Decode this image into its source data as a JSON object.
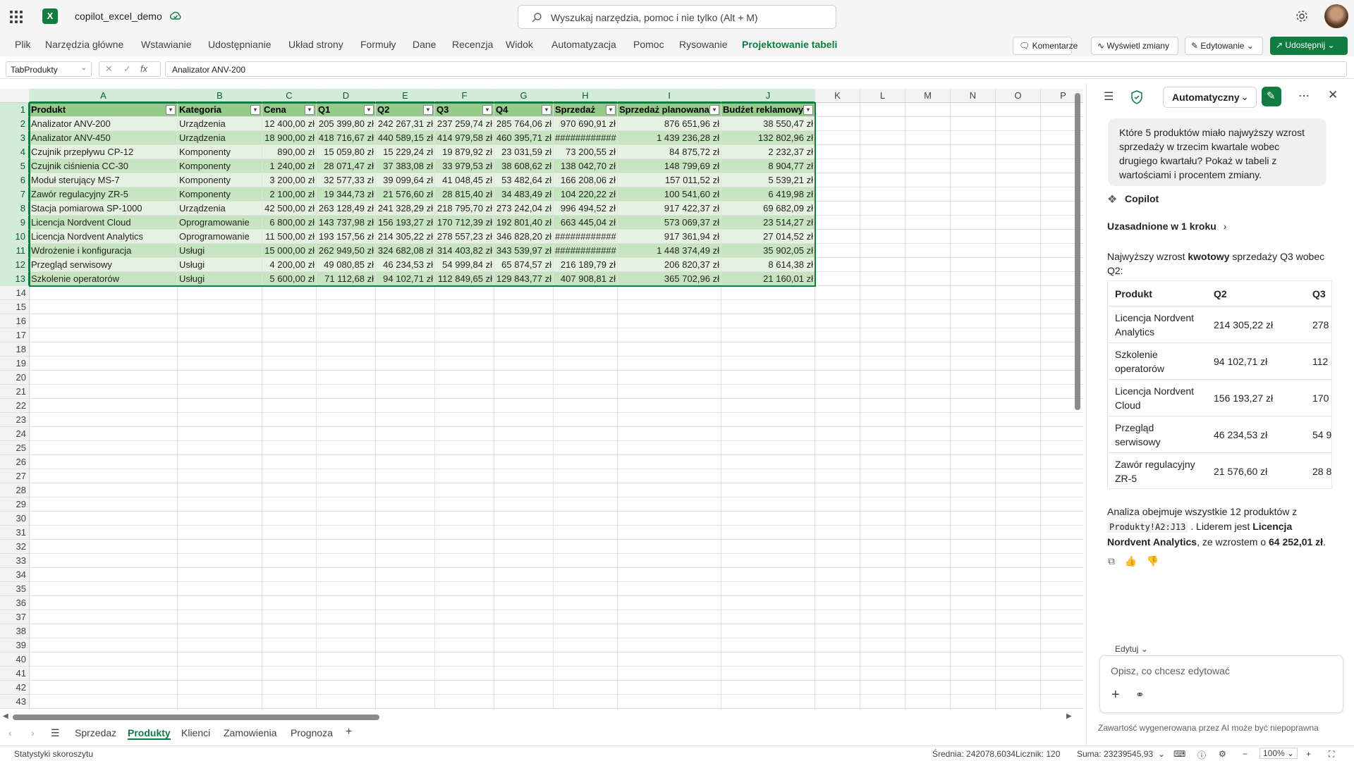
{
  "app": {
    "doc_title": "copilot_excel_demo",
    "search_placeholder": "Wyszukaj narzędzia, pomoc i nie tylko (Alt + M)"
  },
  "menu": [
    "Plik",
    "Narzędzia główne",
    "Wstawianie",
    "Udostępnianie",
    "Układ strony",
    "Formuły",
    "Dane",
    "Recenzja",
    "Widok",
    "Automatyzacja",
    "Pomoc",
    "Rysowanie",
    "Projektowanie tabeli"
  ],
  "menu_active": "Projektowanie tabeli",
  "toolbar": {
    "comments": "Komentarze",
    "changes": "Wyświetl zmiany",
    "editing": "Edytowanie",
    "share": "Udostępnij"
  },
  "formula_bar": {
    "name_box": "TabProdukty",
    "fx": "fx",
    "formula": "Analizator ANV-200"
  },
  "colors": {
    "accent": "#107c41",
    "table_header": "#96c98c",
    "table_band": "#c7e4c0",
    "table_row": "#e6f2e2"
  },
  "grid": {
    "columns": [
      "A",
      "B",
      "C",
      "D",
      "E",
      "F",
      "G",
      "H",
      "I",
      "J",
      "K",
      "L",
      "M",
      "N",
      "O",
      "P"
    ],
    "table_headers": [
      "Produkt",
      "Kategoria",
      "Cena",
      "Q1",
      "Q2",
      "Q3",
      "Q4",
      "Sprzedaż",
      "Sprzedaż planowana",
      "Budżet reklamowy"
    ],
    "rows": [
      [
        "Analizator ANV-200",
        "Urządzenia",
        "12 400,00 zł",
        "205 399,80 zł",
        "242 267,31 zł",
        "237 259,74 zł",
        "285 764,06 zł",
        "970 690,91 zł",
        "876 651,96 zł",
        "38 550,47 zł"
      ],
      [
        "Analizator ANV-450",
        "Urządzenia",
        "18 900,00 zł",
        "418 716,67 zł",
        "440 589,15 zł",
        "414 979,58 zł",
        "460 395,71 zł",
        "############",
        "1 439 236,28 zł",
        "132 802,96 zł"
      ],
      [
        "Czujnik przepływu CP-12",
        "Komponenty",
        "890,00 zł",
        "15 059,80 zł",
        "15 229,24 zł",
        "19 879,92 zł",
        "23 031,59 zł",
        "73 200,55 zł",
        "84 875,72 zł",
        "2 232,37 zł"
      ],
      [
        "Czujnik ciśnienia CC-30",
        "Komponenty",
        "1 240,00 zł",
        "28 071,47 zł",
        "37 383,08 zł",
        "33 979,53 zł",
        "38 608,62 zł",
        "138 042,70 zł",
        "148 799,69 zł",
        "8 904,77 zł"
      ],
      [
        "Moduł sterujący MS-7",
        "Komponenty",
        "3 200,00 zł",
        "32 577,33 zł",
        "39 099,64 zł",
        "41 048,45 zł",
        "53 482,64 zł",
        "166 208,06 zł",
        "157 011,52 zł",
        "5 539,21 zł"
      ],
      [
        "Zawór regulacyjny ZR-5",
        "Komponenty",
        "2 100,00 zł",
        "19 344,73 zł",
        "21 576,60 zł",
        "28 815,40 zł",
        "34 483,49 zł",
        "104 220,22 zł",
        "100 541,60 zł",
        "6 419,98 zł"
      ],
      [
        "Stacja pomiarowa SP-1000",
        "Urządzenia",
        "42 500,00 zł",
        "263 128,49 zł",
        "241 328,29 zł",
        "218 795,70 zł",
        "273 242,04 zł",
        "996 494,52 zł",
        "917 422,37 zł",
        "69 682,09 zł"
      ],
      [
        "Licencja Nordvent Cloud",
        "Oprogramowanie",
        "6 800,00 zł",
        "143 737,98 zł",
        "156 193,27 zł",
        "170 712,39 zł",
        "192 801,40 zł",
        "663 445,04 zł",
        "573 069,37 zł",
        "23 514,27 zł"
      ],
      [
        "Licencja Nordvent Analytics",
        "Oprogramowanie",
        "11 500,00 zł",
        "193 157,56 zł",
        "214 305,22 zł",
        "278 557,23 zł",
        "346 828,20 zł",
        "############",
        "917 361,94 zł",
        "27 014,52 zł"
      ],
      [
        "Wdrożenie i konfiguracja",
        "Usługi",
        "15 000,00 zł",
        "262 949,50 zł",
        "324 682,08 zł",
        "314 403,82 zł",
        "343 539,97 zł",
        "############",
        "1 448 374,49 zł",
        "35 902,05 zł"
      ],
      [
        "Przegląd serwisowy",
        "Usługi",
        "4 200,00 zł",
        "49 080,85 zł",
        "46 234,53 zł",
        "54 999,84 zł",
        "65 874,57 zł",
        "216 189,79 zł",
        "206 820,37 zł",
        "8 614,38 zł"
      ],
      [
        "Szkolenie operatorów",
        "Usługi",
        "5 600,00 zł",
        "71 112,68 zł",
        "94 102,71 zł",
        "112 849,65 zł",
        "129 843,77 zł",
        "407 908,81 zł",
        "365 702,96 zł",
        "21 160,01 zł"
      ]
    ],
    "visible_row_count": 43
  },
  "sheets": [
    "Sprzedaz",
    "Produkty",
    "Klienci",
    "Zamowienia",
    "Prognoza"
  ],
  "active_sheet": "Produkty",
  "status": {
    "left": "Statystyki skoroszytu",
    "average": "Średnia: 242078,6034",
    "count": "Licznik: 120",
    "sum": "Suma: 23239545,93",
    "zoom": "100%"
  },
  "copilot": {
    "mode": "Automatyczny",
    "user_prompt": "Które 5 produktów miało najwyższy wzrost sprzedaży w trzecim kwartale wobec drugiego kwartału? Pokaż w tabeli z wartościami i procentem zmiany.",
    "name": "Copilot",
    "reasoning": "Uzasadnione w 1 kroku",
    "intro_pre": "Najwyższy wzrost ",
    "intro_bold": "kwotowy",
    "intro_post": " sprzedaży Q3 wobec Q2:",
    "table_headers": [
      "Produkt",
      "Q2",
      "Q3"
    ],
    "table_rows": [
      [
        "Licencja Nordvent Analytics",
        "214 305,22 zł",
        "278"
      ],
      [
        "Szkolenie operatorów",
        "94 102,71 zł",
        "112"
      ],
      [
        "Licencja Nordvent Cloud",
        "156 193,27 zł",
        "170"
      ],
      [
        "Przegląd serwisowy",
        "46 234,53 zł",
        "54 9"
      ],
      [
        "Zawór regulacyjny ZR-5",
        "21 576,60 zł",
        "28 8"
      ]
    ],
    "summary_pre": "Analiza obejmuje wszystkie 12 produktów z ",
    "summary_code": "Produkty!A2:J13",
    "summary_mid": " . Liderem jest ",
    "summary_bold1": "Licencja Nordvent Analytics",
    "summary_mid2": ", ze wzrostem o ",
    "summary_bold2": "64 252,01 zł",
    "summary_end": ".",
    "edit_label": "Edytuj",
    "input_placeholder": "Opisz, co chcesz edytować",
    "disclaimer": "Zawartość wygenerowana przez AI może być niepoprawna"
  }
}
